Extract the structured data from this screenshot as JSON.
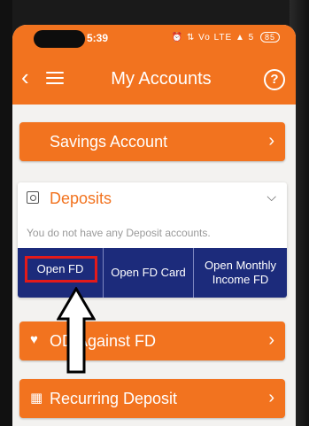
{
  "statusbar": {
    "time": "5:39",
    "icons": "⏰ ⇅ Vo LTE ▲ 5",
    "battery": "85"
  },
  "appbar": {
    "title": "My Accounts",
    "back_icon": "chevron-left-icon",
    "menu_icon": "hamburger-menu-icon",
    "help_icon": "help-icon",
    "help_glyph": "?"
  },
  "savings": {
    "label": "Savings Account",
    "icon": "apple-icon"
  },
  "deposits": {
    "title": "Deposits",
    "message": "You do not have any Deposit accounts.",
    "actions": [
      {
        "label": "Open FD"
      },
      {
        "label": "Open FD Card"
      },
      {
        "label": "Open Monthly Income FD"
      }
    ]
  },
  "od": {
    "label": "OD Against FD",
    "icon": "od-icon"
  },
  "rd": {
    "label": "Recurring Deposit",
    "icon": "calendar-coins-icon"
  },
  "colors": {
    "brand_orange": "#f2731f",
    "action_bar_blue": "#1c2b7b",
    "highlight_red": "#e31a1a"
  }
}
